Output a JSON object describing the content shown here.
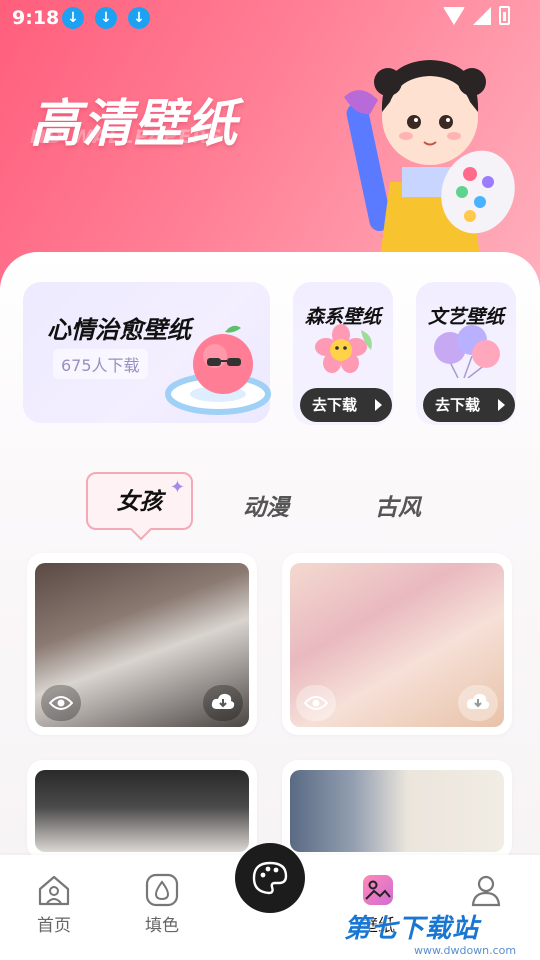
{
  "status_bar": {
    "time": "9:18",
    "download_icons": [
      "download-icon",
      "download-icon",
      "download-icon"
    ]
  },
  "header": {
    "title": "高清壁纸",
    "subtitle": "HD WALLPAPERS"
  },
  "featured": {
    "title": "心情治愈壁纸",
    "count": "675人下载"
  },
  "mini_cards": [
    {
      "title": "森系壁纸",
      "button": "去下载"
    },
    {
      "title": "文艺壁纸",
      "button": "去下载"
    }
  ],
  "tabs": [
    {
      "label": "女孩",
      "active": true
    },
    {
      "label": "动漫",
      "active": false
    },
    {
      "label": "古风",
      "active": false
    }
  ],
  "wallpapers": [
    {
      "icons": [
        "eye-icon",
        "download-icon"
      ]
    },
    {
      "icons": [
        "eye-icon",
        "download-icon"
      ]
    },
    {
      "icons": []
    },
    {
      "icons": []
    }
  ],
  "bottom_nav": [
    {
      "label": "首页",
      "icon": "home-icon"
    },
    {
      "label": "填色",
      "icon": "drop-icon"
    },
    {
      "label": "",
      "icon": "palette-icon"
    },
    {
      "label": "壁纸",
      "icon": "picture-icon"
    },
    {
      "label": "",
      "icon": "user-icon"
    }
  ],
  "watermark": {
    "text": "第七下载站",
    "url": "www.dwdown.com"
  },
  "colors": {
    "header_pink": "#ff5e7c",
    "tab_border": "#f4a9b7",
    "dark": "#333333",
    "watermark_blue": "#1976d2"
  }
}
